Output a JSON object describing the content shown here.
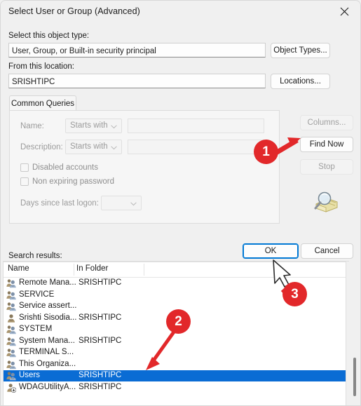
{
  "window": {
    "title": "Select User or Group (Advanced)",
    "close_icon": "close-icon"
  },
  "object_type": {
    "label": "Select this object type:",
    "value": "User, Group, or Built-in security principal",
    "button": "Object Types..."
  },
  "location": {
    "label": "From this location:",
    "value": "SRISHTIPC",
    "button": "Locations..."
  },
  "tabs": [
    {
      "label": "Common Queries"
    }
  ],
  "query": {
    "name_label": "Name:",
    "name_condition": "Starts with",
    "name_value": "",
    "description_label": "Description:",
    "description_condition": "Starts with",
    "description_value": "",
    "disabled_accounts_label": "Disabled accounts",
    "disabled_accounts_checked": false,
    "non_expiring_label": "Non expiring password",
    "non_expiring_checked": false,
    "days_label": "Days since last logon:",
    "days_value": "",
    "chevron_icon": "chevron-down-icon",
    "search_icon": "magnifier-folder-icon"
  },
  "side_buttons": {
    "columns": "Columns...",
    "find_now": "Find Now",
    "stop": "Stop"
  },
  "footer": {
    "ok": "OK",
    "cancel": "Cancel"
  },
  "results": {
    "label": "Search results:",
    "columns": [
      "Name",
      "In Folder"
    ],
    "rows": [
      {
        "name": "Remote Mana...",
        "folder": "SRISHTIPC",
        "icon": "group-icon",
        "selected": false
      },
      {
        "name": "SERVICE",
        "folder": "",
        "icon": "group-icon",
        "selected": false
      },
      {
        "name": "Service assert...",
        "folder": "",
        "icon": "group-icon",
        "selected": false
      },
      {
        "name": "Srishti Sisodia...",
        "folder": "SRISHTIPC",
        "icon": "user-icon",
        "selected": false
      },
      {
        "name": "SYSTEM",
        "folder": "",
        "icon": "group-icon",
        "selected": false
      },
      {
        "name": "System Mana...",
        "folder": "SRISHTIPC",
        "icon": "group-icon",
        "selected": false
      },
      {
        "name": "TERMINAL S...",
        "folder": "",
        "icon": "group-icon",
        "selected": false
      },
      {
        "name": "This Organiza...",
        "folder": "",
        "icon": "group-icon",
        "selected": false
      },
      {
        "name": "Users",
        "folder": "SRISHTIPC",
        "icon": "group-icon",
        "selected": true
      },
      {
        "name": "WDAGUtilityA...",
        "folder": "SRISHTIPC",
        "icon": "user-download-icon",
        "selected": false
      }
    ]
  },
  "annotations": {
    "markers": [
      {
        "label": "1"
      },
      {
        "label": "2"
      },
      {
        "label": "3"
      }
    ],
    "color": "#e2282a"
  }
}
